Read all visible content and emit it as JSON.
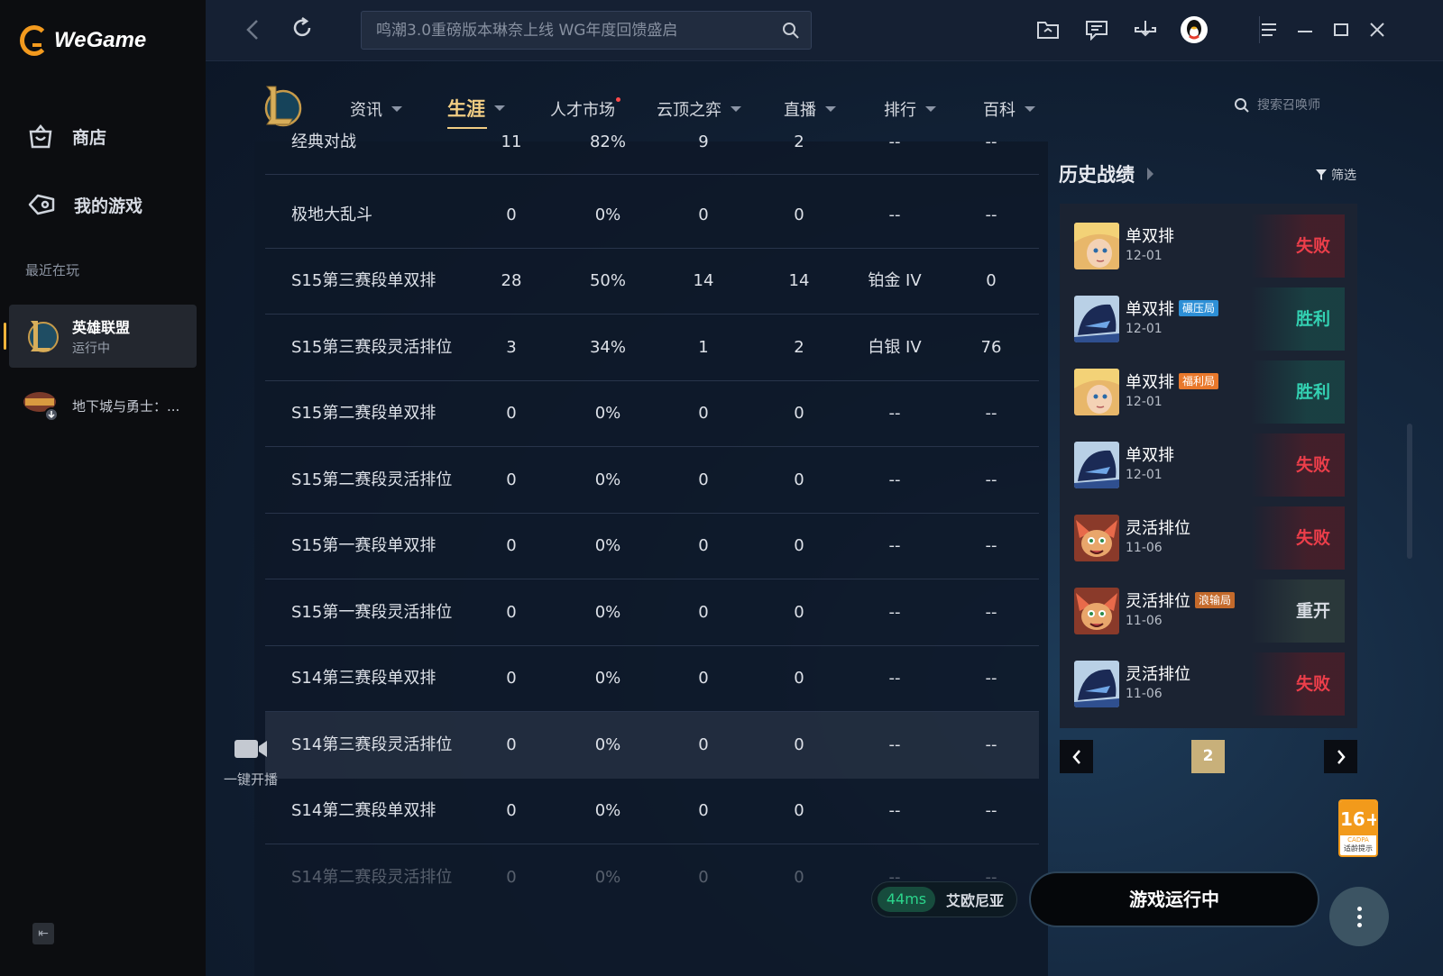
{
  "app": {
    "brand": "WeGame"
  },
  "sidebar": {
    "nav": [
      {
        "label": "商店",
        "icon": "shop-bag-icon"
      },
      {
        "label": "我的游戏",
        "icon": "gamepad-icon"
      }
    ],
    "recent_label": "最近在玩",
    "games": [
      {
        "name": "英雄联盟",
        "status": "运行中"
      },
      {
        "name": "地下城与勇士：..."
      }
    ]
  },
  "topbar": {
    "search_placeholder": "鸣潮3.0重磅版本琳奈上线 WG年度回馈盛启",
    "icons": [
      "folder-icon",
      "message-icon",
      "download-icon",
      "qq-avatar-icon",
      "menu-icon",
      "minimize-icon",
      "maximize-icon",
      "close-icon"
    ]
  },
  "game_nav": {
    "items": [
      {
        "label": "资讯"
      },
      {
        "label": "生涯"
      },
      {
        "label": "人才市场"
      },
      {
        "label": "云顶之弈"
      },
      {
        "label": "直播"
      },
      {
        "label": "排行"
      },
      {
        "label": "百科"
      }
    ],
    "active": "生涯",
    "summoner_search_placeholder": "搜索召唤师"
  },
  "table": {
    "rows": [
      {
        "name": "经典对战",
        "v1": "11",
        "v2": "82%",
        "v3": "9",
        "v4": "2",
        "v5": "--",
        "v6": "--"
      },
      {
        "name": "极地大乱斗",
        "v1": "0",
        "v2": "0%",
        "v3": "0",
        "v4": "0",
        "v5": "--",
        "v6": "--"
      },
      {
        "name": "S15第三赛段单双排",
        "v1": "28",
        "v2": "50%",
        "v3": "14",
        "v4": "14",
        "v5": "铂金 IV",
        "v6": "0"
      },
      {
        "name": "S15第三赛段灵活排位",
        "v1": "3",
        "v2": "34%",
        "v3": "1",
        "v4": "2",
        "v5": "白银 IV",
        "v6": "76"
      },
      {
        "name": "S15第二赛段单双排",
        "v1": "0",
        "v2": "0%",
        "v3": "0",
        "v4": "0",
        "v5": "--",
        "v6": "--"
      },
      {
        "name": "S15第二赛段灵活排位",
        "v1": "0",
        "v2": "0%",
        "v3": "0",
        "v4": "0",
        "v5": "--",
        "v6": "--"
      },
      {
        "name": "S15第一赛段单双排",
        "v1": "0",
        "v2": "0%",
        "v3": "0",
        "v4": "0",
        "v5": "--",
        "v6": "--"
      },
      {
        "name": "S15第一赛段灵活排位",
        "v1": "0",
        "v2": "0%",
        "v3": "0",
        "v4": "0",
        "v5": "--",
        "v6": "--"
      },
      {
        "name": "S14第三赛段单双排",
        "v1": "0",
        "v2": "0%",
        "v3": "0",
        "v4": "0",
        "v5": "--",
        "v6": "--"
      },
      {
        "name": "S14第三赛段灵活排位",
        "v1": "0",
        "v2": "0%",
        "v3": "0",
        "v4": "0",
        "v5": "--",
        "v6": "--"
      },
      {
        "name": "S14第二赛段单双排",
        "v1": "0",
        "v2": "0%",
        "v3": "0",
        "v4": "0",
        "v5": "--",
        "v6": "--"
      },
      {
        "name": "S14第二赛段灵活排位",
        "v1": "0",
        "v2": "0%",
        "v3": "0",
        "v4": "0",
        "v5": "--",
        "v6": "--"
      }
    ]
  },
  "live": {
    "label": "一键开播"
  },
  "history": {
    "title": "历史战绩",
    "filter_label": "筛选",
    "items": [
      {
        "mode": "单双排",
        "tag": "",
        "date": "12-01",
        "result": "失败"
      },
      {
        "mode": "单双排",
        "tag": "碾压局",
        "date": "12-01",
        "result": "胜利"
      },
      {
        "mode": "单双排",
        "tag": "福利局",
        "date": "12-01",
        "result": "胜利"
      },
      {
        "mode": "单双排",
        "tag": "",
        "date": "12-01",
        "result": "失败"
      },
      {
        "mode": "灵活排位",
        "tag": "",
        "date": "11-06",
        "result": "失败"
      },
      {
        "mode": "灵活排位",
        "tag": "浪输局",
        "date": "11-06",
        "result": "重开"
      },
      {
        "mode": "灵活排位",
        "tag": "",
        "date": "11-06",
        "result": "失败"
      }
    ],
    "page": "2"
  },
  "age_rating": {
    "label": "16+",
    "line1": "CADPA",
    "line2": "适龄提示"
  },
  "bottom": {
    "ping": "44ms",
    "region": "艾欧尼亚",
    "run_label": "游戏运行中"
  },
  "colors": {
    "accent_gold": "#f1cd83",
    "win": "#33d1b2",
    "lose": "#ec3e4a",
    "brand_orange": "#f39a1e"
  }
}
